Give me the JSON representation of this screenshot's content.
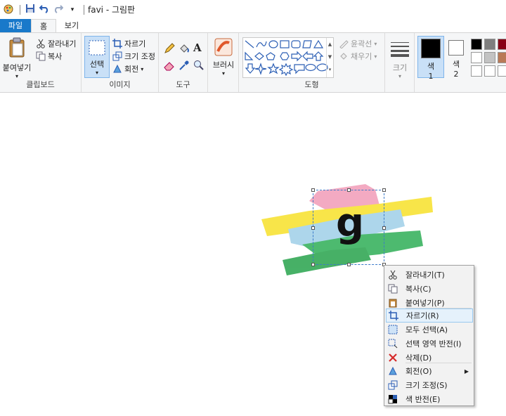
{
  "titlebar": {
    "title": "favi - 그림판"
  },
  "tabs": [
    {
      "label": "파일"
    },
    {
      "label": "홈"
    },
    {
      "label": "보기"
    }
  ],
  "clipboard": {
    "paste": "붙여넣기",
    "cut": "잘라내기",
    "copy": "복사",
    "group": "클립보드"
  },
  "image": {
    "select": "선택",
    "crop": "자르기",
    "resize": "크기 조정",
    "rotate": "회전",
    "group": "이미지"
  },
  "tools": {
    "group": "도구"
  },
  "brushes": {
    "label": "브러시"
  },
  "shapes": {
    "outline": "윤곽선",
    "fill": "채우기",
    "group": "도형"
  },
  "size": {
    "label": "크기"
  },
  "color1": {
    "label_line1": "색",
    "label_line2": "1"
  },
  "color2": {
    "label_line1": "색",
    "label_line2": "2"
  },
  "palette": [
    "#000000",
    "#7f7f7f",
    "#880015",
    "#ffffff",
    "#c3c3c3",
    "#b97a57",
    "#ffffff",
    "#ffffff",
    "#ffffff"
  ],
  "canvas_image": {
    "glyph": "g"
  },
  "context_menu": {
    "items": [
      {
        "label": "잘라내기(T)",
        "icon": "scissors-icon"
      },
      {
        "label": "복사(C)",
        "icon": "copy-icon"
      },
      {
        "label": "붙여넣기(P)",
        "icon": "paste-icon"
      },
      {
        "label": "자르기(R)",
        "icon": "crop-icon",
        "highlighted": true
      },
      {
        "label": "모두 선택(A)",
        "icon": "select-all-icon"
      },
      {
        "label": "선택 영역 반전(I)",
        "icon": "invert-selection-icon"
      },
      {
        "label": "삭제(D)",
        "icon": "delete-icon"
      },
      {
        "label": "회전(O)",
        "icon": "rotate-icon",
        "submenu": true
      },
      {
        "label": "크기 조정(S)",
        "icon": "resize-icon"
      },
      {
        "label": "색 반전(E)",
        "icon": "invert-color-icon"
      }
    ]
  }
}
